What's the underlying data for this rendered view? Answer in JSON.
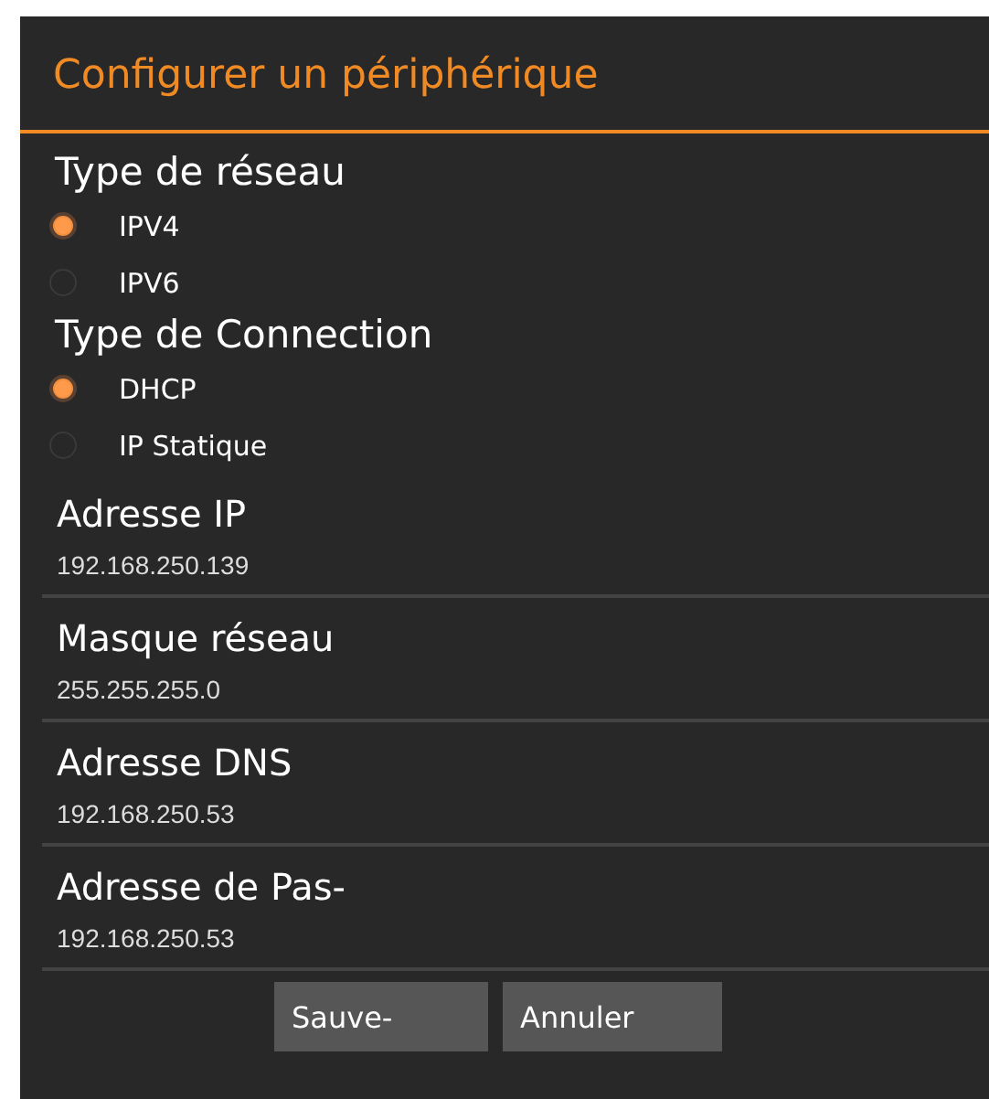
{
  "dialog": {
    "title": "Configurer un périphérique"
  },
  "groups": [
    {
      "label": "Type de réseau",
      "options": [
        {
          "label": "IPV4",
          "selected": true
        },
        {
          "label": "IPV6",
          "selected": false
        }
      ]
    },
    {
      "label": "Type de Connection",
      "options": [
        {
          "label": "DHCP",
          "selected": true
        },
        {
          "label": "IP Statique",
          "selected": false
        }
      ]
    }
  ],
  "fields": [
    {
      "label": "Adresse IP",
      "value": "192.168.250.139"
    },
    {
      "label": "Masque réseau",
      "value": "255.255.255.0"
    },
    {
      "label": "Adresse DNS",
      "value": "192.168.250.53"
    },
    {
      "label": "Adresse de Pas-",
      "value": "192.168.250.53"
    }
  ],
  "buttons": [
    "Sauve-",
    "Annuler"
  ]
}
